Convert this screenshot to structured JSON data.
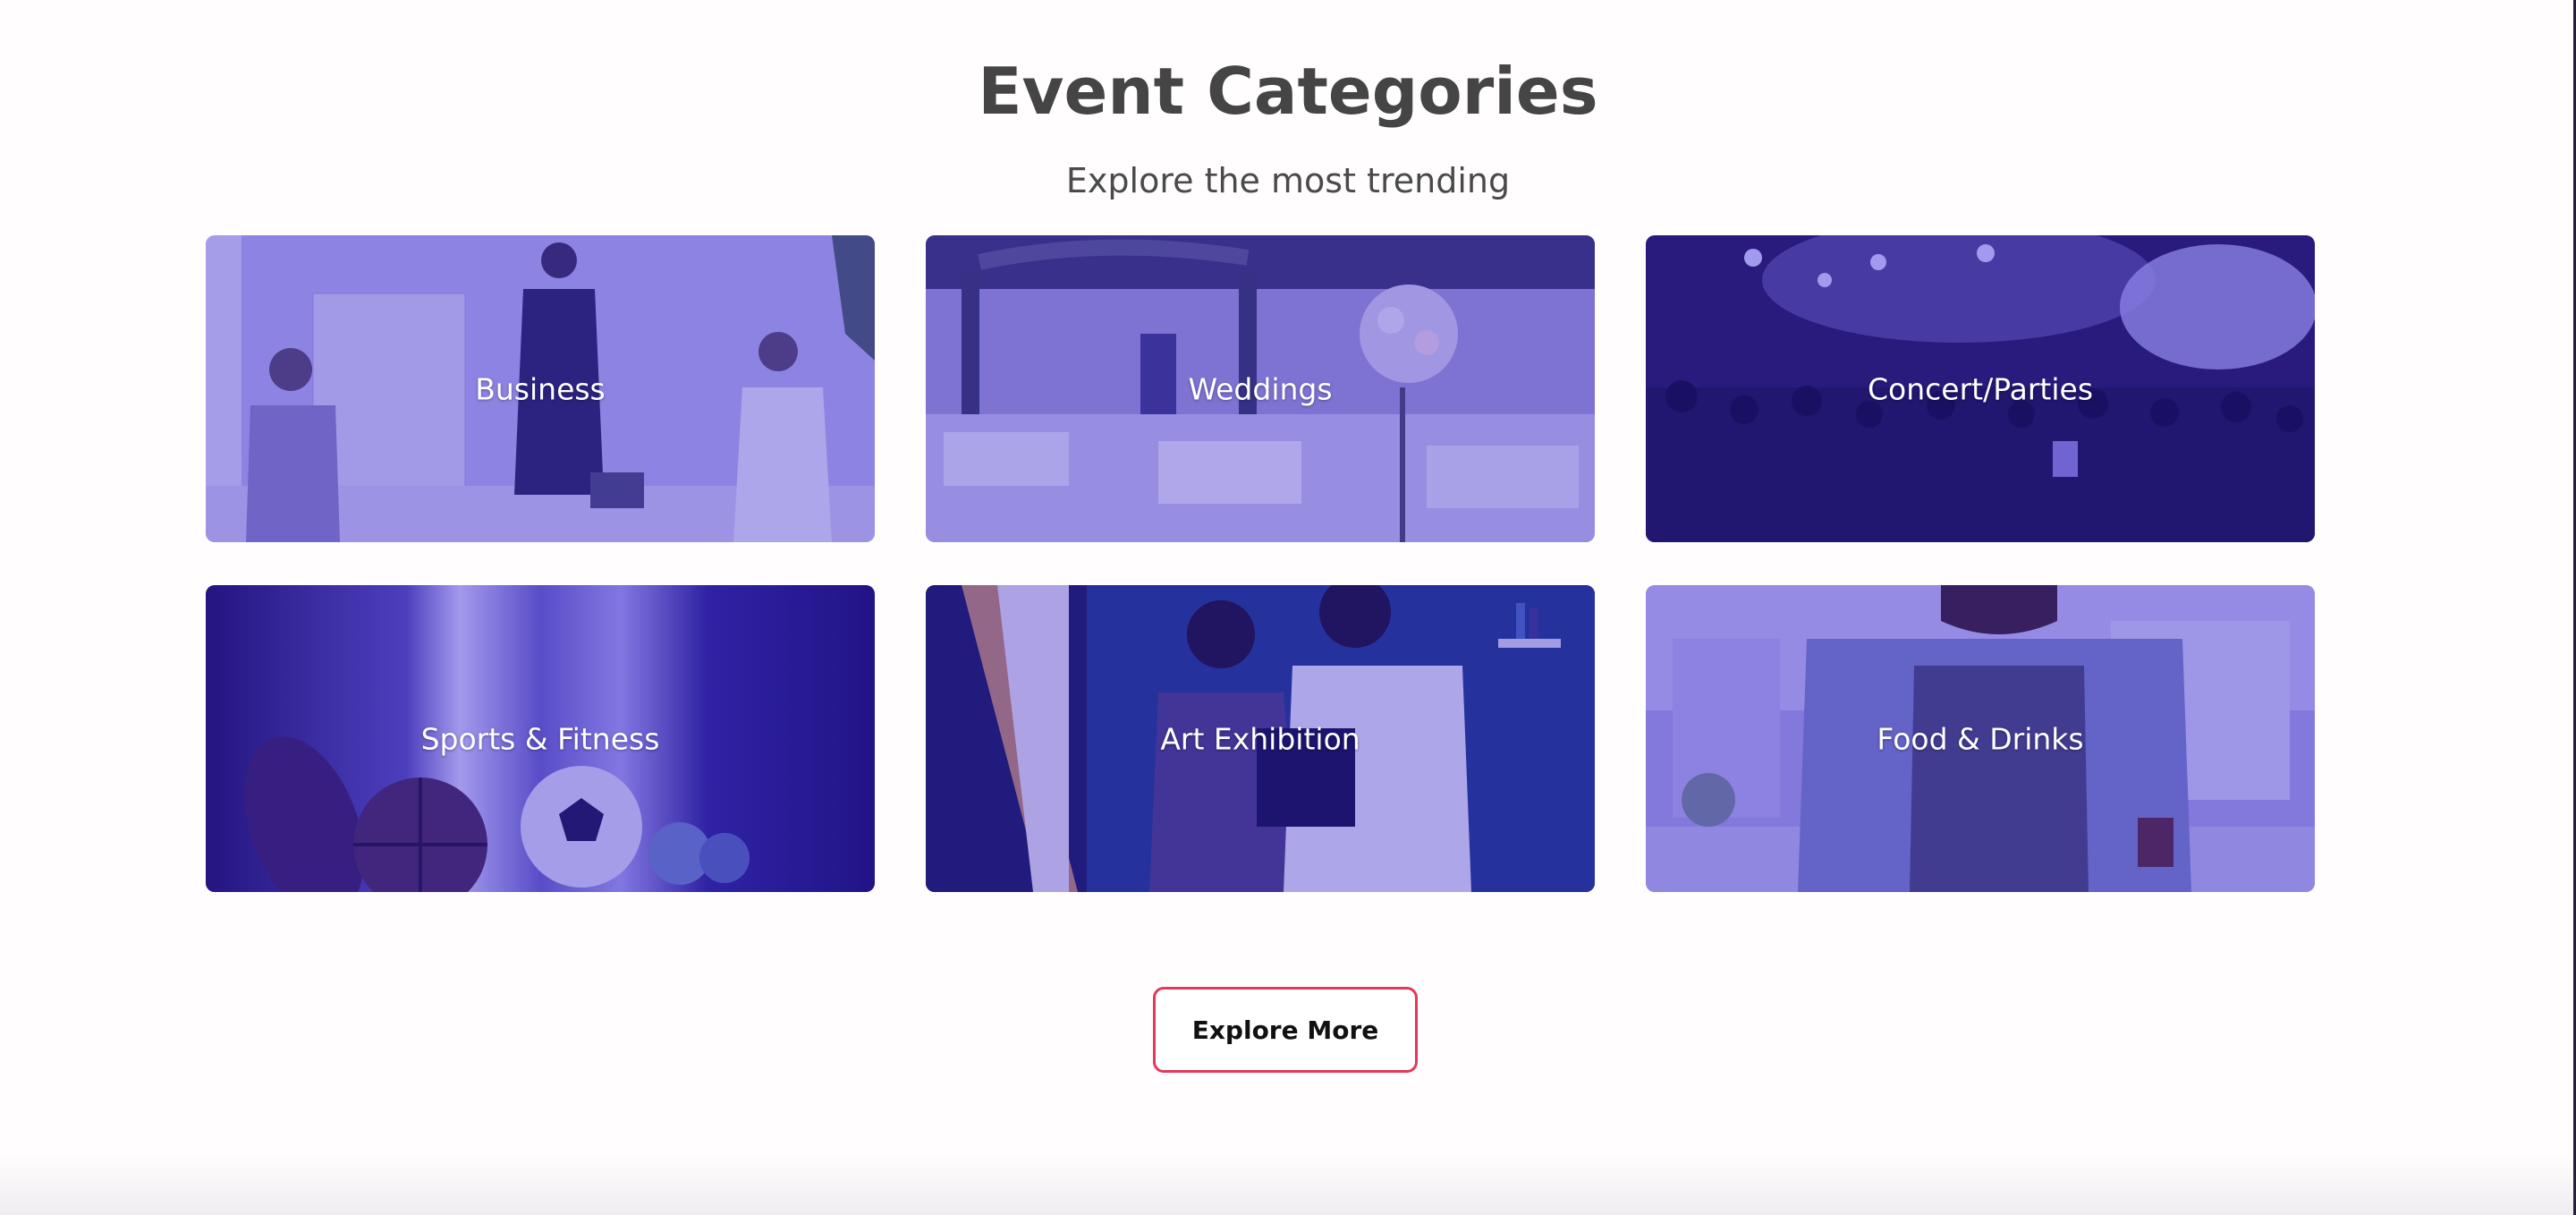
{
  "section": {
    "title": "Event Categories",
    "subtitle": "Explore the most trending"
  },
  "categories": [
    {
      "label": "Business",
      "image": "business-meeting-image"
    },
    {
      "label": "Weddings",
      "image": "wedding-hall-image"
    },
    {
      "label": "Concert/Parties",
      "image": "concert-crowd-image"
    },
    {
      "label": "Sports & Fitness",
      "image": "sports-balls-image"
    },
    {
      "label": "Art Exhibition",
      "image": "painting-artists-image"
    },
    {
      "label": "Food & Drinks",
      "image": "chef-smiling-image"
    }
  ],
  "explore_button": {
    "label": "Explore More"
  },
  "colors": {
    "heading": "#454545",
    "card_tint": "#3a22c8",
    "button_border": "#e2395a"
  }
}
